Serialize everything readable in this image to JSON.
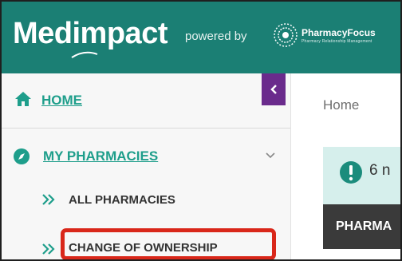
{
  "header": {
    "brand": "Medimpact",
    "powered_by": "powered by",
    "partner_name": "PharmacyFocus",
    "partner_tagline": "Pharmacy Relationship Management",
    "bg_color": "#1b7f74"
  },
  "sidebar": {
    "collapse_icon": "chevron-left-icon",
    "items": [
      {
        "label": "HOME",
        "icon": "home-icon"
      },
      {
        "label": "MY PHARMACIES",
        "icon": "compass-icon",
        "expanded": true
      }
    ],
    "subitems": [
      {
        "label": "ALL PHARMACIES",
        "icon": "double-chevron-right-icon"
      },
      {
        "label": "CHANGE OF OWNERSHIP",
        "icon": "double-chevron-right-icon",
        "highlighted": true
      }
    ],
    "accent_color": "#1e9e8b",
    "collapse_color": "#6a2b8c",
    "highlight_color": "#d9271a"
  },
  "main": {
    "breadcrumb": "Home",
    "alert_text": "6 n",
    "alert_icon": "exclamation-circle-icon",
    "table_header": "PHARMA"
  }
}
